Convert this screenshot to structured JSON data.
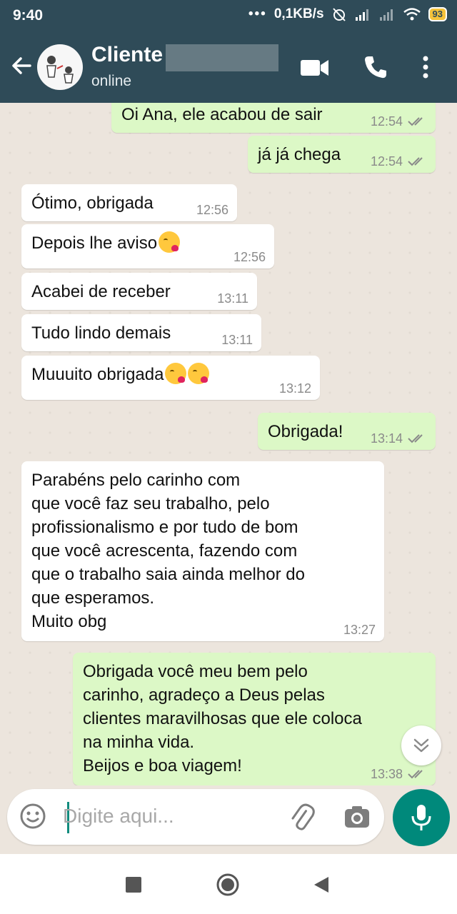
{
  "status_bar": {
    "time": "9:40",
    "network_speed": "0,1KB/s",
    "battery": "93",
    "icons": [
      "more-icon",
      "alarm-off-icon",
      "signal-icon",
      "signal-2-icon",
      "wifi-icon",
      "battery-icon"
    ]
  },
  "header": {
    "contact_name": "Cliente",
    "contact_status": "online",
    "icons": [
      "back-arrow-icon",
      "avatar",
      "video-call-icon",
      "phone-icon",
      "more-vert-icon"
    ]
  },
  "messages": [
    {
      "direction": "out",
      "text": "Oi Ana, ele acabou de sair",
      "time": "12:54",
      "ticks": "read"
    },
    {
      "direction": "out",
      "text": "já já chega",
      "time": "12:54",
      "ticks": "read"
    },
    {
      "direction": "in",
      "text": "Ótimo, obrigada",
      "time": "12:56"
    },
    {
      "direction": "in",
      "text": "Depois lhe aviso",
      "time": "12:56",
      "emoji_count": 1
    },
    {
      "direction": "in",
      "text": "Acabei de receber",
      "time": "13:11"
    },
    {
      "direction": "in",
      "text": "Tudo lindo demais",
      "time": "13:11"
    },
    {
      "direction": "in",
      "text": "Muuuito obrigada",
      "time": "13:12",
      "emoji_count": 2
    },
    {
      "direction": "out",
      "text": "Obrigada!",
      "time": "13:14",
      "ticks": "read"
    },
    {
      "direction": "in",
      "lines": [
        "Parabéns pelo carinho com",
        "que você faz seu trabalho, pelo",
        "profissionalismo e por tudo de bom",
        "que você acrescenta, fazendo com",
        "que o trabalho saia ainda melhor do",
        "que esperamos.",
        "Muito obg"
      ],
      "time": "13:27"
    },
    {
      "direction": "out",
      "lines": [
        "Obrigada você meu bem pelo",
        "carinho, agradeço a Deus pelas",
        "clientes maravilhosas que ele coloca",
        "na minha vida.",
        "Beijos e boa viagem!"
      ],
      "time": "13:38",
      "ticks": "read"
    }
  ],
  "composer": {
    "placeholder": "Digite aqui...",
    "icons": [
      "emoji-icon",
      "attach-icon",
      "camera-icon",
      "mic-icon"
    ]
  },
  "colors": {
    "header": "#2f4b58",
    "chat_background": "#ece5dd",
    "incoming_bubble": "#ffffff",
    "outgoing_bubble": "#dcf8c6",
    "accent": "#00897b"
  }
}
